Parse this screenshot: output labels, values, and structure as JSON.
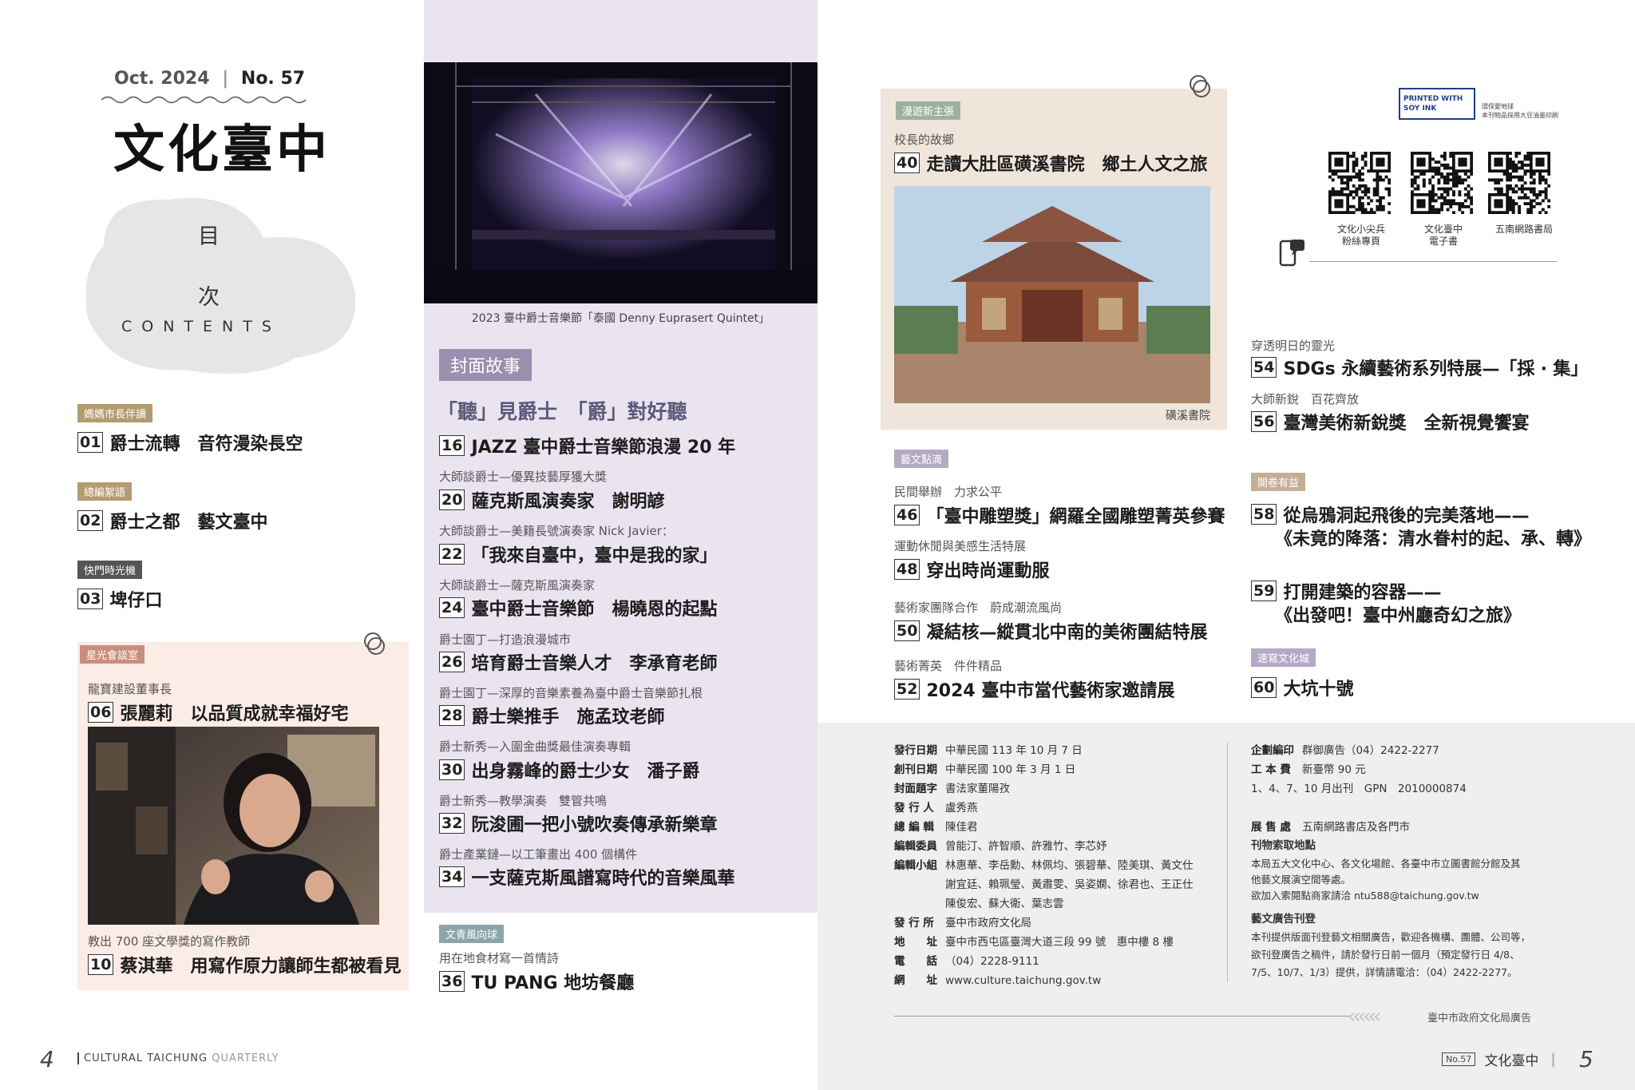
{
  "masthead": {
    "issue_date": "Oct. 2024",
    "issue_no": "No. 57",
    "logo": "文化臺中",
    "contents_cjk_1": "目",
    "contents_cjk_2": "次",
    "contents_en": "CONTENTS"
  },
  "left_column": [
    {
      "tag": "媽媽市長伴讀",
      "num": "01",
      "title": "爵士流轉　音符漫染長空"
    },
    {
      "tag": "總編絮語",
      "num": "02",
      "title": "爵士之都　藝文臺中"
    },
    {
      "tag": "快門時光機",
      "num": "03",
      "title": "埤仔口"
    }
  ],
  "star_talk": {
    "tag": "星光會談室",
    "entry1": {
      "kicker": "龍寶建設董事長",
      "num": "06",
      "title": "張麗莉　以品質成就幸福好宅"
    },
    "entry2": {
      "kicker": "教出 700 座文學獎的寫作教師",
      "num": "10",
      "title": "蔡淇華　用寫作原力讓師生都被看見"
    }
  },
  "cover": {
    "photo_caption": "2023 臺中爵士音樂節「泰國 Denny Euprasert Quintet」",
    "label": "封面故事",
    "headline": "「聽」見爵士　「爵」對好聽",
    "entries": [
      {
        "kicker": "",
        "num": "16",
        "title": "JAZZ 臺中爵士音樂節浪漫 20 年"
      },
      {
        "kicker": "大師談爵士—優異技藝厚獲大獎",
        "num": "20",
        "title": "薩克斯風演奏家　謝明諺"
      },
      {
        "kicker": "大師談爵士—美籍長號演奏家 Nick Javier：",
        "num": "22",
        "title": "「我來自臺中，臺中是我的家」"
      },
      {
        "kicker": "大師談爵士—薩克斯風演奏家",
        "num": "24",
        "title": "臺中爵士音樂節　楊曉恩的起點"
      },
      {
        "kicker": "爵士園丁—打造浪漫城市",
        "num": "26",
        "title": "培育爵士音樂人才　李承育老師"
      },
      {
        "kicker": "爵士園丁—深厚的音樂素養為臺中爵士音樂節扎根",
        "num": "28",
        "title": "爵士樂推手　施孟玟老師"
      },
      {
        "kicker": "爵士新秀—入圍金曲獎最佳演奏專輯",
        "num": "30",
        "title": "出身霧峰的爵士少女　潘子爵"
      },
      {
        "kicker": "爵士新秀—教學演奏　雙管共鳴",
        "num": "32",
        "title": "阮浚圃一把小號吹奏傳承新樂章"
      },
      {
        "kicker": "爵士產業鏈—以工筆畫出 400 個構件",
        "num": "34",
        "title": "一支薩克斯風譜寫時代的音樂風華"
      }
    ]
  },
  "youth": {
    "tag": "文青風向球",
    "kicker": "用在地食材寫一首情詩",
    "num": "36",
    "title": "TU PANG 地坊餐廳"
  },
  "tour": {
    "tag": "漫遊新主張",
    "kicker": "校長的故鄉",
    "num": "40",
    "title": "走讀大肚區磺溪書院　鄉土人文之旅",
    "photo_caption": "磺溪書院"
  },
  "arts": {
    "tag": "藝文點滴",
    "entries": [
      {
        "kicker": "民間舉辦　力求公平",
        "num": "46",
        "title": "「臺中雕塑獎」網羅全國雕塑菁英參賽"
      },
      {
        "kicker": "運動休閒與美感生活特展",
        "num": "48",
        "title": "穿出時尚運動服"
      },
      {
        "kicker": "藝術家團隊合作　蔚成潮流風尚",
        "num": "50",
        "title": "凝結核—縱貫北中南的美術團結特展"
      },
      {
        "kicker": "藝術菁英　件件精品",
        "num": "52",
        "title": "2024 臺中市當代藝術家邀請展"
      }
    ]
  },
  "right_column": {
    "soy_ink": "PRINTED WITH SOY INK",
    "soy_note_1": "環保愛地球",
    "soy_note_2": "本刊物品採用大豆油墨印刷",
    "qr_codes": [
      {
        "line1": "文化小尖兵",
        "line2": "粉絲專頁"
      },
      {
        "line1": "文化臺中",
        "line2": "電子書"
      },
      {
        "line1": "五南網路書局",
        "line2": ""
      }
    ],
    "entries_a": [
      {
        "kicker": "穿透明日的靈光",
        "num": "54",
        "title": "SDGs 永續藝術系列特展—「採 ‧ 集」"
      },
      {
        "kicker": "大師新銳　百花齊放",
        "num": "56",
        "title": "臺灣美術新銳獎　全新視覺饗宴"
      }
    ],
    "open_tag": "開卷有益",
    "entry58": {
      "num": "58",
      "line1": "從烏鴉洞起飛後的完美落地——",
      "line2": "《未竟的降落：清水眷村的起、承、轉》"
    },
    "entry59": {
      "num": "59",
      "line1": "打開建築的容器——",
      "line2": "《出發吧！臺中州廳奇幻之旅》"
    },
    "sketch_tag": "速寫文化城",
    "entry60": {
      "num": "60",
      "title": "大坑十號"
    }
  },
  "colophon_left": [
    {
      "label": "發行日期",
      "value": "中華民國 113 年 10 月 7 日"
    },
    {
      "label": "創刊日期",
      "value": "中華民國 100 年 3 月 1 日"
    },
    {
      "label": "封面題字",
      "value": "書法家董陽孜"
    },
    {
      "label": "發 行 人",
      "value": "盧秀燕"
    },
    {
      "label": "總 編 輯",
      "value": "陳佳君"
    },
    {
      "label": "編輯委員",
      "value": "曾能汀、許智順、許雅竹、李芯妤"
    },
    {
      "label": "編輯小組",
      "value": "林惠華、李岳勳、林佩均、張碧華、陸美琪、黃文仕"
    },
    {
      "label": "",
      "value": "謝宜廷、賴珮瑩、黃肅雯、吳姿嫻、徐君也、王正仕"
    },
    {
      "label": "",
      "value": "陳俊宏、蘇大衛、葉志雲"
    },
    {
      "label": "發 行 所",
      "value": "臺中市政府文化局"
    },
    {
      "label": "地　　址",
      "value": "臺中市西屯區臺灣大道三段 99 號　惠中樓 8 樓"
    },
    {
      "label": "電　　話",
      "value": "（04）2228-9111"
    },
    {
      "label": "網　　址",
      "value": "www.culture.taichung.gov.tw"
    }
  ],
  "colophon_right": {
    "plan_label": "企劃編印",
    "plan_value": "群御廣告（04）2422-2277",
    "cost_label": "工 本 費",
    "cost_value": "新臺幣 90 元",
    "schedule": "1、4、7、10 月出刊　GPN　2010000874",
    "sale_label": "展 售 處",
    "sale_value": "五南網路書店及各門市",
    "pickup_title": "刊物索取地點",
    "pickup_text_1": "本局五大文化中心、各文化場館、各臺中市立圖書館分館及其",
    "pickup_text_2": "他藝文展演空間等處。",
    "pickup_text_3": "欲加入索閱點商家請洽 ntu588@taichung.gov.tw",
    "ad_title": "藝文廣告刊登",
    "ad_text_1": "本刊提供版面刊登藝文相關廣告，歡迎各機構、團體、公司等，",
    "ad_text_2": "欲刊登廣告之稿件，請於發行日前一個月（預定發行日 4/8、",
    "ad_text_3": "7/5、10/7、1/3）提供，詳情請電洽：（04）2422-2277。",
    "ad_footer": "臺中市政府文化局廣告"
  },
  "footer": {
    "left_page": "4",
    "left_label": "CULTURAL TAICHUNG",
    "left_label_light": "QUARTERLY",
    "right_no": "No.57",
    "right_label": "文化臺中",
    "right_page": "5"
  },
  "colors": {
    "lavender_panel": "#e9e4f0",
    "pink_panel": "#fcece6",
    "beige_panel": "#efe5da",
    "gray_panel": "#efefef"
  }
}
